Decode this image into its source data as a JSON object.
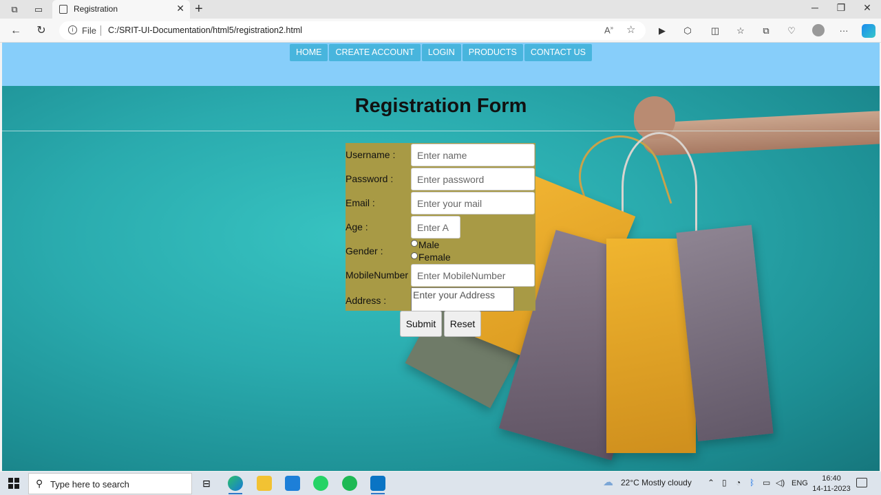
{
  "browser": {
    "tab_title": "Registration",
    "address_prefix": "File",
    "url": "C:/SRIT-UI-Documentation/html5/registration2.html"
  },
  "nav": {
    "items": [
      "HOME",
      "CREATE ACCOUNT",
      "LOGIN",
      "PRODUCTS",
      "CONTACT US"
    ]
  },
  "page": {
    "title": "Registration Form"
  },
  "form": {
    "username_label": "Username :",
    "username_placeholder": "Enter name",
    "password_label": "Password :",
    "password_placeholder": "Enter password",
    "email_label": "Email :",
    "email_placeholder": "Enter your mail",
    "age_label": "Age :",
    "age_placeholder": "Enter A",
    "gender_label": "Gender :",
    "gender_options": [
      "Male",
      "Female"
    ],
    "mobile_label": "MobileNumber :",
    "mobile_placeholder": "Enter MobileNumber",
    "address_label": "Address :",
    "address_placeholder": "Enter your Address",
    "submit_label": "Submit",
    "reset_label": "Reset"
  },
  "taskbar": {
    "search_placeholder": "Type here to search",
    "weather": "22°C  Mostly cloudy",
    "language": "ENG",
    "time": "16:40",
    "date": "14-11-2023"
  },
  "colors": {
    "nav_band": "#87cefa",
    "nav_button": "#48b5dd",
    "form_bg": "#a89a45",
    "page_bg": "#2aabae"
  }
}
